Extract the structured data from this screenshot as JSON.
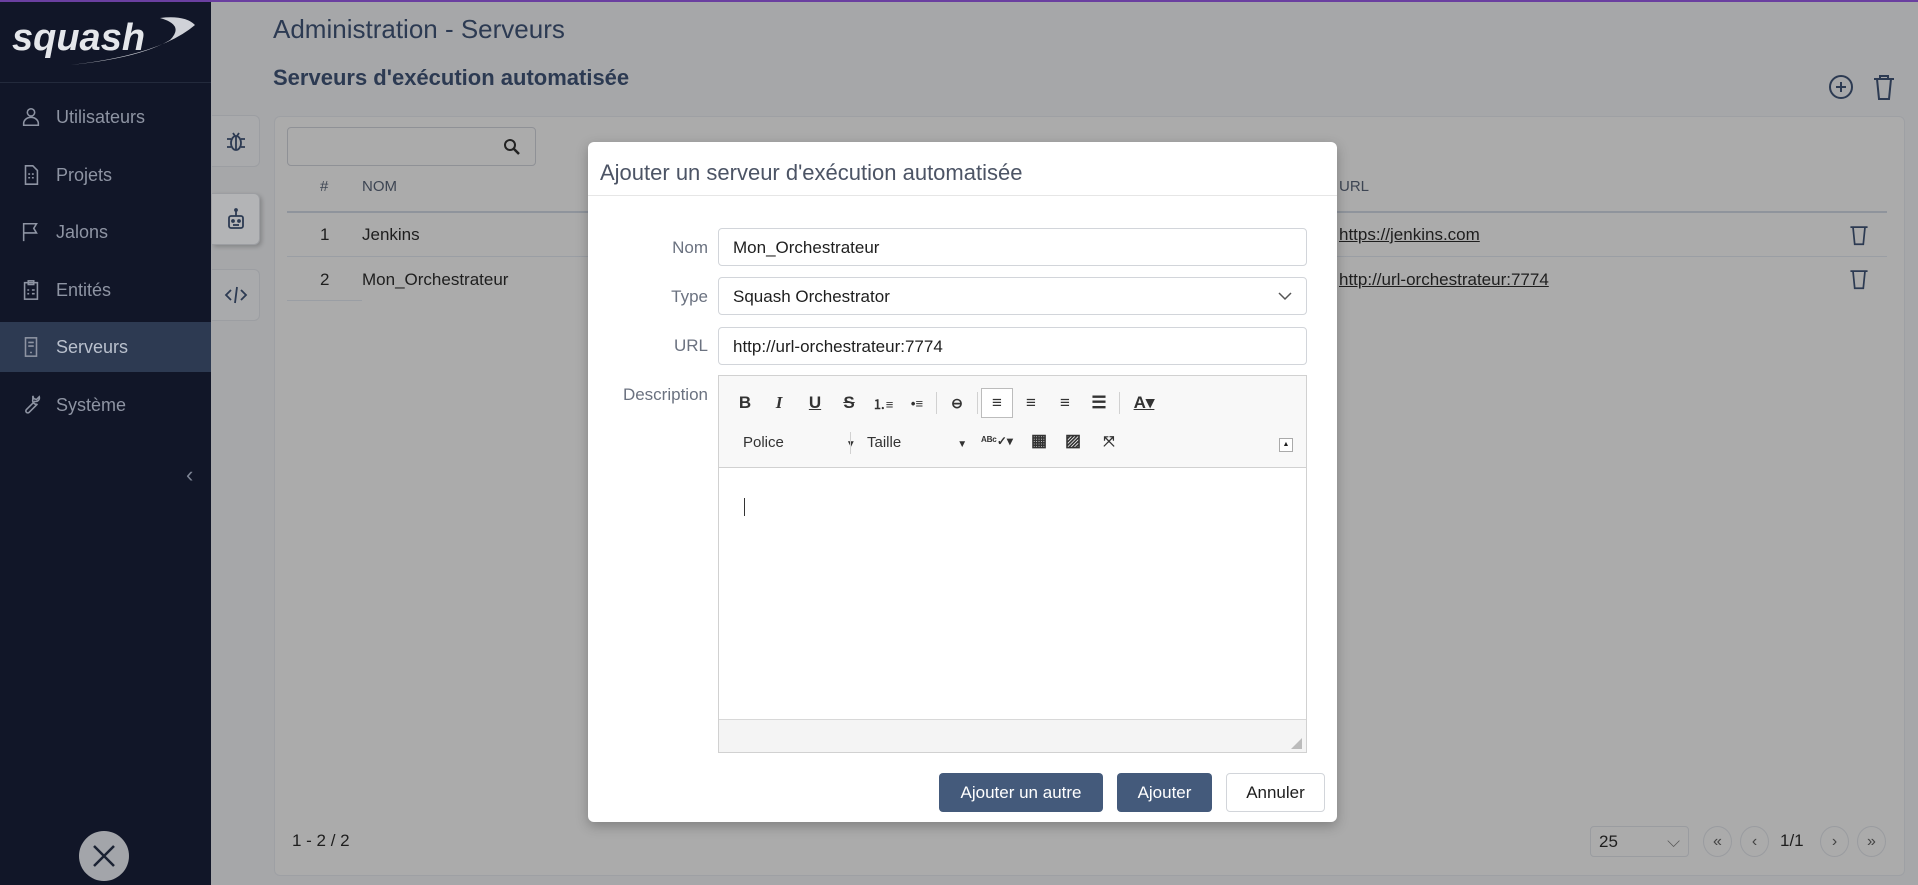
{
  "logo": "squash",
  "sidebar": {
    "items": [
      {
        "label": "Utilisateurs",
        "icon": "user-icon"
      },
      {
        "label": "Projets",
        "icon": "document-icon"
      },
      {
        "label": "Jalons",
        "icon": "flag-icon"
      },
      {
        "label": "Entités",
        "icon": "clipboard-icon"
      },
      {
        "label": "Serveurs",
        "icon": "server-icon",
        "active": true
      },
      {
        "label": "Système",
        "icon": "wrench-icon"
      }
    ],
    "collapse": "‹"
  },
  "header": {
    "title": "Administration - Serveurs",
    "subtitle": "Serveurs d'exécution automatisée"
  },
  "table": {
    "columns": {
      "index": "#",
      "name": "NOM",
      "url": "URL"
    },
    "rows": [
      {
        "index": "1",
        "name": "Jenkins",
        "url": "https://jenkins.com"
      },
      {
        "index": "2",
        "name": "Mon_Orchestrateur",
        "url": "http://url-orchestrateur:7774"
      }
    ],
    "count": "1 - 2 / 2",
    "page_size": "25",
    "page": "1/1"
  },
  "modal": {
    "title": "Ajouter un serveur d'exécution automatisée",
    "fields": {
      "name_label": "Nom",
      "name_value": "Mon_Orchestrateur",
      "type_label": "Type",
      "type_value": "Squash Orchestrator",
      "url_label": "URL",
      "url_value": "http://url-orchestrateur:7774",
      "description_label": "Description"
    },
    "toolbar": {
      "font": "Police",
      "size": "Taille"
    },
    "buttons": {
      "add_another": "Ajouter un autre",
      "add": "Ajouter",
      "cancel": "Annuler"
    }
  },
  "colors": {
    "sidebar": "#111628",
    "primary": "#445a7b",
    "active_nav": "#2d3a52"
  }
}
